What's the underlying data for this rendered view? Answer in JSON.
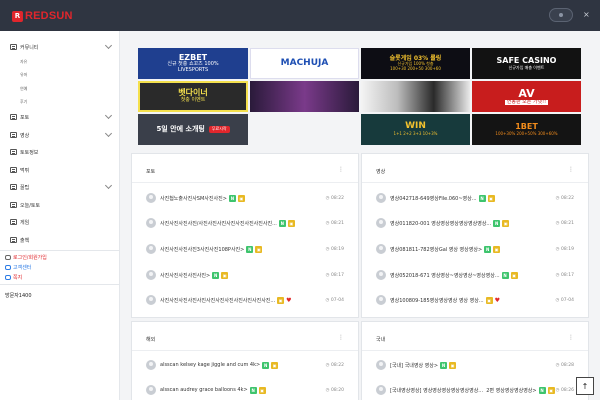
{
  "header": {
    "logo_text": "REDSUN",
    "logo_mark": "R",
    "brand_color": "#e0262c",
    "close_icon": "×"
  },
  "sidebar": {
    "menu": [
      {
        "label": "커뮤니티",
        "has_children": true
      },
      {
        "label": "포토",
        "has_children": true
      },
      {
        "label": "영상",
        "has_children": true
      },
      {
        "label": "토토정보",
        "has_children": false
      },
      {
        "label": "먹튀",
        "has_children": false
      },
      {
        "label": "꿀팁",
        "has_children": true
      },
      {
        "label": "오늘/토토",
        "has_children": false
      },
      {
        "label": "게임",
        "has_children": false
      },
      {
        "label": "출첵",
        "has_children": false
      }
    ],
    "sub_items": [
      "자유",
      "유머",
      "연예",
      "후기"
    ],
    "links": [
      {
        "label": "로그인/회원가입",
        "color": "#e0262c"
      },
      {
        "label": "고객센터",
        "color": "#2c7be5"
      },
      {
        "label": "쪽지",
        "color": "#e0262c"
      }
    ],
    "visitors": "방문자1400"
  },
  "banners": [
    {
      "main": "EZBET",
      "sub": "신규 첫충 쇼꼬즈 100%",
      "sub2": "LIVESPORTS",
      "bg": "#1f3f8f",
      "fg": "#ffffff"
    },
    {
      "main": "MACHUJA",
      "sub": "",
      "sub2": "",
      "bg": "#ffffff",
      "fg": "#1e4fb3"
    },
    {
      "main": "슬롯게임 03% 롤링",
      "sub": "신규가입 100% 첫충",
      "sub2": "100+30 200+50 300+60",
      "bg": "#0d0d14",
      "fg": "#f2c12e"
    },
    {
      "main": "SAFE CASINO",
      "sub": "신규가입 매충 이벤트",
      "sub2": "",
      "bg": "#121212",
      "fg": "#ffffff"
    },
    {
      "main": "벳다이너",
      "sub": "첫충 이벤트",
      "sub2": "",
      "bg": "#2a2a2a",
      "fg": "#f4e04d"
    },
    {
      "main": "",
      "sub": "",
      "sub2": "",
      "bg": "#2a1a3a",
      "fg": "#ffffff"
    },
    {
      "main": "",
      "sub": "",
      "sub2": "",
      "bg": "#dcdcdc",
      "fg": "#222222"
    },
    {
      "main": "AV",
      "sub": "연동판 오픈 가넷!!",
      "sub2": "",
      "bg": "#c81d1d",
      "fg": "#ffffff"
    },
    {
      "main": "5일 안에 소개팅",
      "sub": "무료시작",
      "sub2": "",
      "bg": "#3a3f4a",
      "fg": "#ffffff"
    },
    {
      "main": "WIN",
      "sub": "1+1 2+2 3+3 10+3%",
      "sub2": "",
      "bg": "#173a3c",
      "fg": "#f2c12e"
    },
    {
      "main": "1BET",
      "sub": "100+30% 200+50% 300+60%",
      "sub2": "",
      "bg": "#141414",
      "fg": "#f28c1c"
    }
  ],
  "boards": [
    {
      "title": "포토",
      "posts": [
        {
          "title": "사진첩노출사진사SM사진사진>",
          "time": "08:22",
          "new": true,
          "img": true,
          "heart": false
        },
        {
          "title": "사진사진사진사진/사진사진사진사진사진사진사진사진...",
          "time": "08:21",
          "new": true,
          "img": true,
          "heart": false
        },
        {
          "title": "사진사진사진사진3사진사진108P사진>",
          "time": "08:19",
          "new": true,
          "img": true,
          "heart": false
        },
        {
          "title": "사진사진사진사진사진>",
          "time": "08:17",
          "new": true,
          "img": true,
          "heart": false
        },
        {
          "title": "사진사진사진사진사진사진사진사진사진사진사진사진...",
          "time": "07-04",
          "new": false,
          "img": true,
          "heart": true
        }
      ]
    },
    {
      "title": "영상",
      "posts": [
        {
          "title": "영상042718-649영상File.060~영상...",
          "time": "08:22",
          "new": true,
          "img": true,
          "heart": false
        },
        {
          "title": "영상011820-001 영상영상영상영상영상영상...",
          "time": "08:21",
          "new": true,
          "img": true,
          "heart": false
        },
        {
          "title": "영상081811-782영상Gal 영상 영상영상>",
          "time": "08:19",
          "new": true,
          "img": true,
          "heart": false
        },
        {
          "title": "영상052018-671 영상영상~영상영상~영상영상...",
          "time": "08:17",
          "new": true,
          "img": true,
          "heart": false
        },
        {
          "title": "영상100809-185영상영상영상 영상 영상...",
          "time": "07-04",
          "new": false,
          "img": true,
          "heart": true
        }
      ]
    },
    {
      "title": "해외",
      "posts": [
        {
          "title": "alsscan kelsey kage jiggle and cum 4k>",
          "time": "08:22",
          "new": true,
          "img": true,
          "heart": false
        },
        {
          "title": "alsscan audrey grace balloons 4k>",
          "time": "08:20",
          "new": true,
          "img": true,
          "heart": false
        }
      ]
    },
    {
      "title": "국내",
      "posts": [
        {
          "title": "[국내] 국내영상 영상>",
          "time": "08:28",
          "new": true,
          "img": true,
          "heart": false
        },
        {
          "title": "[국내영상영상] 영상영상영상영상영상영상...  2편 영상영상영상영상>",
          "time": "08:26",
          "new": true,
          "img": true,
          "heart": false
        }
      ]
    }
  ],
  "badges": {
    "new": "N",
    "img": "▣",
    "heart": "♥",
    "time_icon": "◷",
    "menu_icon": "⋮",
    "to_top": "↑"
  }
}
